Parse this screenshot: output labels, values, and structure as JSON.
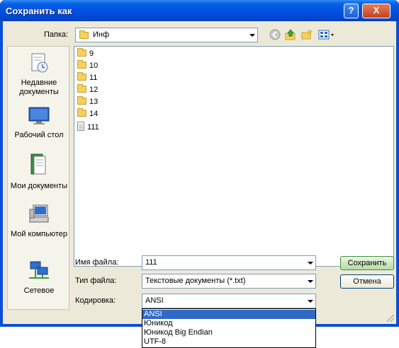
{
  "window": {
    "title": "Сохранить как",
    "help_label": "?",
    "close_label": "X"
  },
  "toolbar": {
    "folder_label": "Папка:",
    "folder_value": "Инф",
    "icons": [
      "back-icon",
      "up-folder-icon",
      "new-folder-icon",
      "view-menu-icon"
    ]
  },
  "places": [
    {
      "label": "Недавние документы",
      "icon": "recent-documents-icon"
    },
    {
      "label": "Рабочий стол",
      "icon": "desktop-icon"
    },
    {
      "label": "Мои документы",
      "icon": "my-documents-icon"
    },
    {
      "label": "Мой компьютер",
      "icon": "my-computer-icon"
    },
    {
      "label": "Сетевое",
      "icon": "network-icon"
    }
  ],
  "files": [
    {
      "name": "9",
      "type": "folder"
    },
    {
      "name": "10",
      "type": "folder"
    },
    {
      "name": "11",
      "type": "folder"
    },
    {
      "name": "12",
      "type": "folder"
    },
    {
      "name": "13",
      "type": "folder"
    },
    {
      "name": "14",
      "type": "folder"
    },
    {
      "name": "111",
      "type": "file"
    }
  ],
  "form": {
    "filename_label": "Имя файла:",
    "filename_value": "111",
    "filetype_label": "Тип файла:",
    "filetype_value": "Текстовые документы (*.txt)",
    "encoding_label": "Кодировка:",
    "encoding_value": "ANSI"
  },
  "buttons": {
    "save": "Сохранить",
    "cancel": "Отмена"
  },
  "encoding_options": [
    "ANSI",
    "Юникод",
    "Юникод Big Endian",
    "UTF-8"
  ],
  "encoding_selected": "ANSI"
}
